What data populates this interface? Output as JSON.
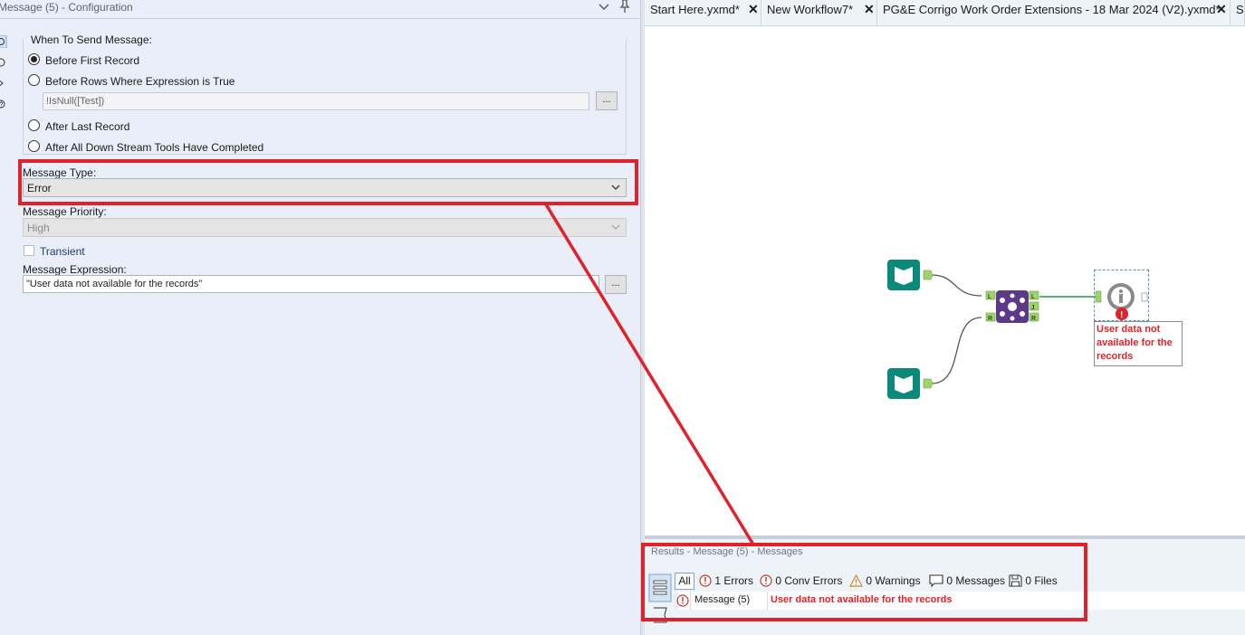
{
  "config": {
    "title": "Message (5) - Configuration",
    "when_to_send_label": "When To Send Message:",
    "options": [
      {
        "label": "Before First Record",
        "selected": true
      },
      {
        "label": "Before Rows Where Expression is True",
        "selected": false
      },
      {
        "label": "After Last Record",
        "selected": false
      },
      {
        "label": "After All Down Stream Tools Have Completed",
        "selected": false
      }
    ],
    "expression_value": "!IsNull([Test])",
    "dots_label": "...",
    "message_type_label": "Message Type:",
    "message_type_value": "Error",
    "message_priority_label": "Message Priority:",
    "message_priority_value": "High",
    "transient_label": "Transient",
    "message_expression_label": "Message Expression:",
    "message_expression_value": "\"User data not available for the records\""
  },
  "tabs": [
    {
      "label": "Start Here.yxmd*"
    },
    {
      "label": "New Workflow7*"
    },
    {
      "label": "PG&E Corrigo Work Order Extensions - 18 Mar 2024 (V2).yxmd*"
    },
    {
      "label": "Sc"
    }
  ],
  "canvas": {
    "tool_message_lines": [
      "User data not",
      "available for the",
      "records"
    ],
    "anchor_labels": {
      "left": "L",
      "right": "R",
      "join": "J"
    }
  },
  "results": {
    "title": "Results - Message (5) - Messages",
    "all_label": "All",
    "errors_label": "1 Errors",
    "conv_errors_label": "0 Conv Errors",
    "warnings_label": "0 Warnings",
    "messages_label": "0 Messages",
    "files_label": "0 Files",
    "rows": [
      {
        "tool": "Message (5)",
        "message": "User data not available for the records"
      }
    ]
  },
  "colors": {
    "highlight_red": "#e0222a",
    "input_tool_teal": "#0b8a7b",
    "join_tool_purple": "#5c3a88",
    "anchor_green": "#9fd36b"
  }
}
